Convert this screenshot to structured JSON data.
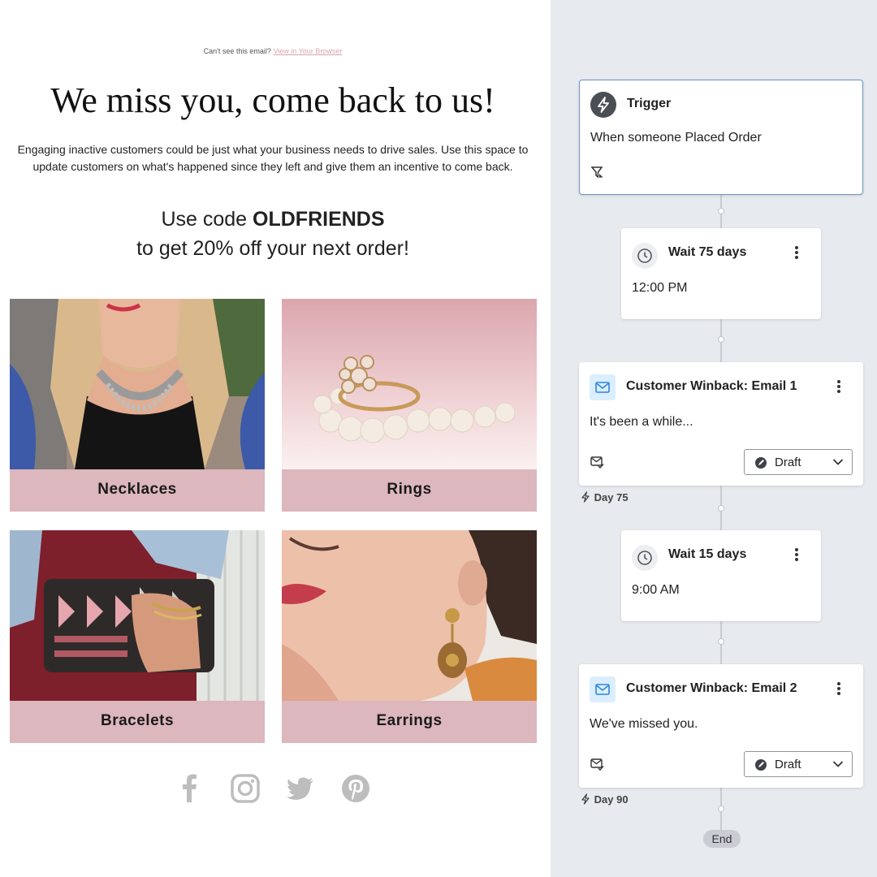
{
  "email": {
    "preheader_text": "Can't see this email?",
    "preheader_link": "View in Your Browser",
    "headline": "We miss you, come back to us!",
    "intro": "Engaging inactive customers could be just what your business needs to drive sales. Use this space to update customers on what's happened since they left and give them an incentive to come back.",
    "promo_prefix": "Use code",
    "promo_code": "OLDFRIENDS",
    "promo_suffix": "to get 20% off your next order!",
    "categories": [
      {
        "label": "Necklaces"
      },
      {
        "label": "Rings"
      },
      {
        "label": "Bracelets"
      },
      {
        "label": "Earrings"
      }
    ],
    "social_icons": [
      "facebook-icon",
      "instagram-icon",
      "twitter-icon",
      "pinterest-icon"
    ],
    "colors": {
      "label_bg": "#dcb7bd",
      "link": "#d8a3ac",
      "social": "#bdbdbd"
    }
  },
  "flow": {
    "trigger": {
      "title": "Trigger",
      "text": "When someone Placed Order"
    },
    "wait1": {
      "title": "Wait 75 days",
      "time": "12:00 PM"
    },
    "email1": {
      "title": "Customer Winback: Email 1",
      "preview": "It's been a while...",
      "status": "Draft",
      "day": "Day 75"
    },
    "wait2": {
      "title": "Wait 15 days",
      "time": "9:00 AM"
    },
    "email2": {
      "title": "Customer Winback: Email 2",
      "preview": "We've missed you.",
      "status": "Draft",
      "day": "Day 90"
    },
    "end_label": "End",
    "colors": {
      "canvas": "#e7eaee",
      "trigger_border": "#6d95c8",
      "mail_icon_bg": "#dbeefd",
      "mail_icon": "#2e86de"
    }
  }
}
